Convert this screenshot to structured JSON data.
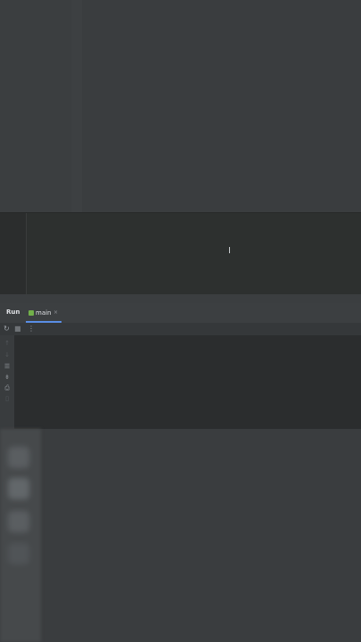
{
  "run_panel": {
    "title": "Run",
    "tab": {
      "label": "main",
      "close": "×"
    }
  },
  "toolbar": {
    "rerun_icon": "rerun-icon",
    "stop_icon": "stop-icon",
    "more_icon": "more-vertical-icon"
  },
  "editor": {
    "cursor": "I"
  }
}
